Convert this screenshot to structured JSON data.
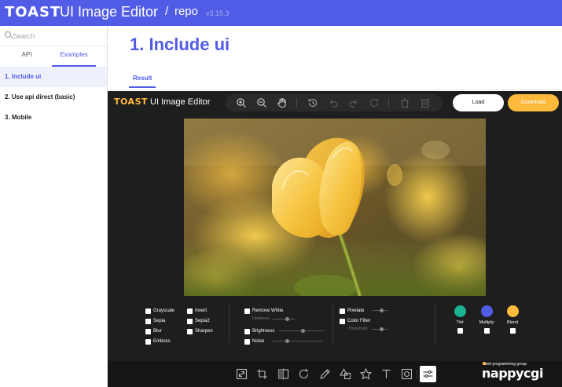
{
  "header": {
    "logo": "TOAST",
    "title": "UI Image Editor",
    "separator": "/",
    "repo": "repo",
    "version": "v3.15.3",
    "color": "#515ce6"
  },
  "sidebar": {
    "search": {
      "placeholder": "Search",
      "icon": "search-icon"
    },
    "tabs": [
      {
        "label": "API",
        "active": false
      },
      {
        "label": "Examples",
        "active": true
      }
    ],
    "items": [
      {
        "label": "1. Include ui",
        "active": true
      },
      {
        "label": "2. Use api direct (basic)",
        "active": false
      },
      {
        "label": "3. Mobile",
        "active": false
      }
    ]
  },
  "main": {
    "title": "1. Include ui",
    "result_tab": "Result"
  },
  "editor": {
    "logo_bold": "TOAST",
    "logo_rest": " UI Image Editor",
    "top_tools": [
      "zoom-in-icon",
      "zoom-out-icon",
      "hand-icon",
      "history-icon",
      "undo-icon",
      "redo-icon",
      "reset-icon",
      "delete-icon",
      "delete-all-icon"
    ],
    "load_label": "Load",
    "download_label": "Download",
    "accent": "#fdba3b",
    "image": {
      "subject": "yellow tulip"
    },
    "filters": {
      "col1": [
        "Grayscale",
        "Sepia",
        "Blur",
        "Emboss"
      ],
      "col2": [
        "Invert",
        "Sepia2",
        "Sharpen"
      ],
      "remove_white": "Remove White",
      "distance": "Distance",
      "brightness": "Brightness",
      "noise": "Noise",
      "pixelate": "Pixelate",
      "color_filter": "Color Filter",
      "threshold": "Threshold",
      "swatches": [
        {
          "label": "Tint",
          "color": "#1ab394"
        },
        {
          "label": "Multiply",
          "color": "#515ce6"
        },
        {
          "label": "Blend",
          "color": "#fdba3b"
        }
      ]
    },
    "bottom_tools": [
      "resize-icon",
      "crop-icon",
      "flip-icon",
      "rotate-icon",
      "draw-icon",
      "shape-icon",
      "icon-tool-icon",
      "text-icon",
      "mask-icon",
      "filter-icon"
    ],
    "active_tool": "filter-icon"
  },
  "watermark": {
    "tagline": "web programming group",
    "name": "nappycgi"
  }
}
